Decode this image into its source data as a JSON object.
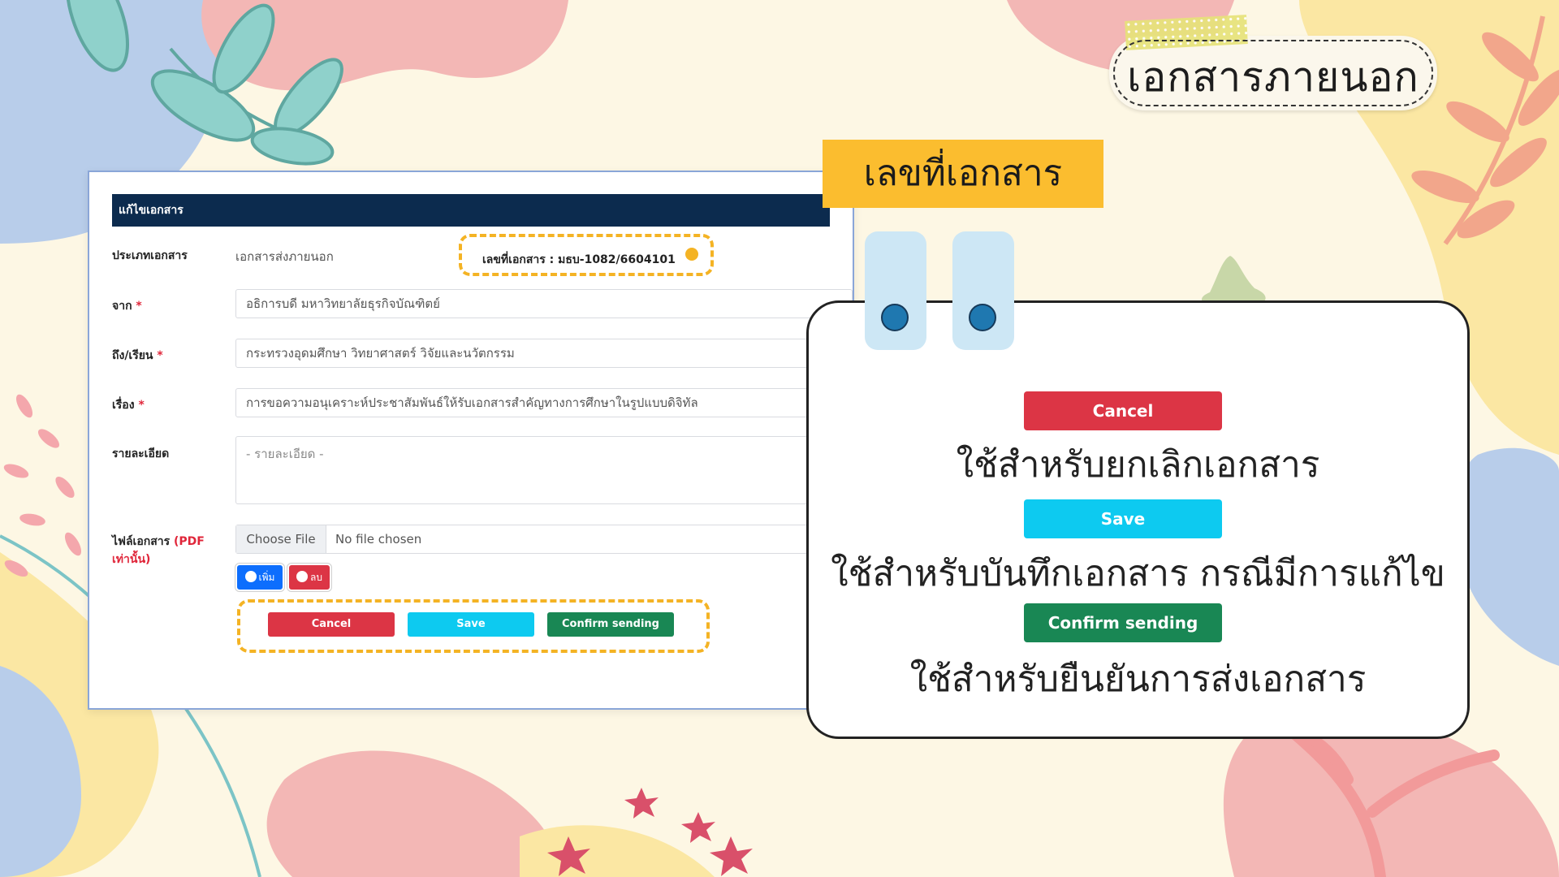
{
  "page_title": "เอกสารภายนอก",
  "callout_label": "เลขที่เอกสาร",
  "form": {
    "header": "แก้ไขเอกสาร",
    "doc_type_label": "ประเภทเอกสาร",
    "doc_type_value": "เอกสารส่งภายนอก",
    "doc_number": "เลขที่เอกสาร : มธบ-1082/6604101",
    "from_label": "จาก",
    "from_value": "อธิการบดี มหาวิทยาลัยธุรกิจบัณฑิตย์",
    "to_label": "ถึง/เรียน",
    "to_value": "กระทรวงอุดมศึกษา วิทยาศาสตร์ วิจัยและนวัตกรรม",
    "subject_label": "เรื่อง",
    "subject_value": "การขอความอนุเคราะห์ประชาสัมพันธ์ให้รับเอกสารสำคัญทางการศึกษาในรูปแบบดิจิทัล",
    "detail_label": "รายละเอียด",
    "detail_placeholder": "- รายละเอียด -",
    "file_label": "ไฟล์เอกสาร",
    "file_note": "(PDF เท่านั้น)",
    "file_button": "Choose File",
    "file_status": "No file chosen",
    "required_mark": "*",
    "add_button": "เพิ่ม",
    "delete_button": "ลบ",
    "cancel_button": "Cancel",
    "save_button": "Save",
    "confirm_button": "Confirm sending"
  },
  "card": {
    "cancel_button": "Cancel",
    "cancel_desc": "ใช้สำหรับยกเลิกเอกสาร",
    "save_button": "Save",
    "save_desc": "ใช้สำหรับบันทึกเอกสาร กรณีมีการแก้ไข",
    "confirm_button": "Confirm sending",
    "confirm_desc": "ใช้สำหรับยืนยันการส่งเอกสาร"
  },
  "colors": {
    "background": "#fdf7e4",
    "accent_yellow": "#fbbd2f",
    "header_navy": "#0c2b4e",
    "cancel_red": "#dc3545",
    "save_cyan": "#0dcaf0",
    "confirm_green": "#198754",
    "add_blue": "#0d6efd"
  }
}
